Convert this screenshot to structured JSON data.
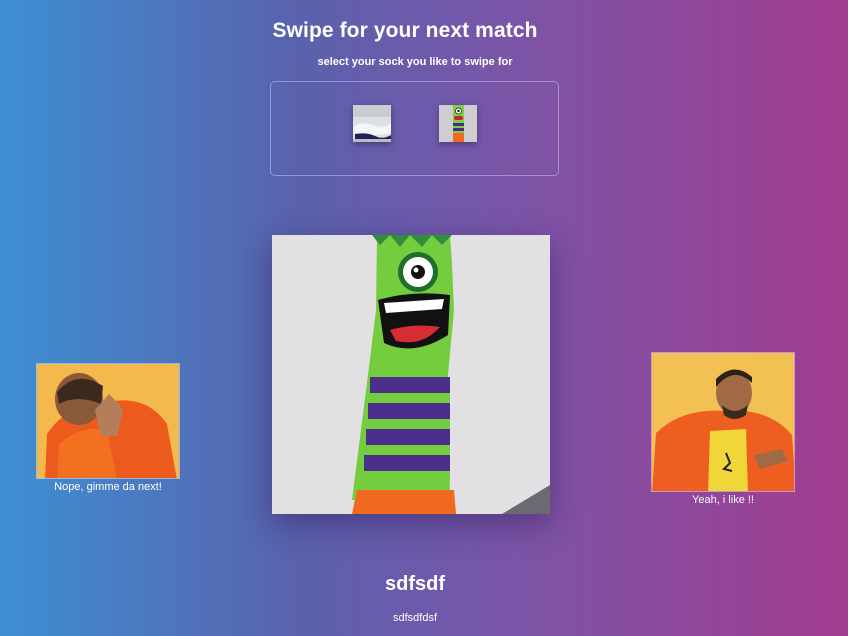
{
  "header": {
    "title": "Swipe for your next match",
    "subtitle": "select your sock you like to swipe for"
  },
  "sock_picker": {
    "items": [
      {
        "icon": "white-sock-thumbnail"
      },
      {
        "icon": "green-monster-sock-thumbnail"
      }
    ]
  },
  "candidate": {
    "image_icon": "green-monster-sock-photo",
    "name": "sdfsdf",
    "description": "sdfsdfdsf"
  },
  "actions": {
    "reject_label": "Nope, gimme da next!",
    "accept_label": "Yeah, i like !!"
  },
  "colors": {
    "gradient_left": "#3d8fd3",
    "gradient_right": "#a23d90",
    "text": "#ffffff"
  }
}
